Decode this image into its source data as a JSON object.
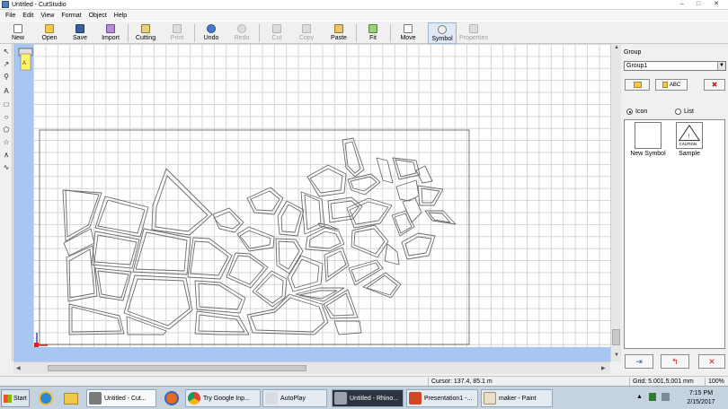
{
  "window": {
    "title": "Untitled - CutStudio",
    "controls": [
      "–",
      "□",
      "✕"
    ]
  },
  "menu": [
    "File",
    "Edit",
    "View",
    "Format",
    "Object",
    "Help"
  ],
  "toolbar": {
    "new": "New",
    "open": "Open",
    "save": "Save",
    "import": "Import",
    "cutting": "Cutting",
    "print": "Print",
    "undo": "Undo",
    "redo": "Redo",
    "cut": "Cut",
    "copy": "Copy",
    "paste": "Paste",
    "fit": "Fit",
    "move": "Move",
    "symbol": "Symbol",
    "properties": "Properties"
  },
  "right_panel": {
    "group_label": "Group",
    "group_value": "Group1",
    "abc_label": "ABC",
    "view_icon": "Icon",
    "view_list": "List",
    "symbols": [
      "New Symbol",
      "Sample"
    ],
    "caution_text": "CAUTION"
  },
  "status": {
    "cursor": "Cursor: 137.4, 85.1 m",
    "grid": "Grid: 5.001,5.001 mm",
    "zoom": "100%"
  },
  "taskbar": {
    "start": "Start",
    "tasks": [
      "Untitled - Cut...",
      "Try Google Inp...",
      "AutoPlay",
      "Untitled - Rhino...",
      "Presentation1 -...",
      "maker - Paint"
    ],
    "time": "7:15 PM",
    "date": "2/15/2017"
  },
  "colors": {
    "canvas_bg": "#a7c7f2",
    "grid_line": "#d6d6d6",
    "taskbar": "#c5d3e1"
  }
}
